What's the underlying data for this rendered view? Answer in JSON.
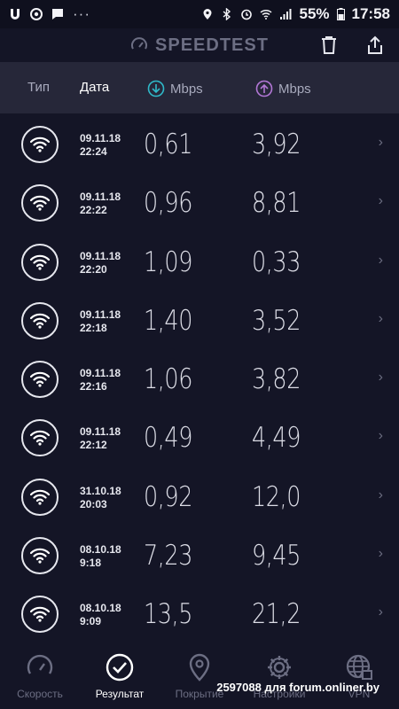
{
  "status_bar": {
    "battery": "55%",
    "time": "17:58",
    "left_icons": [
      "u-app-icon",
      "chrome-icon",
      "message-icon"
    ],
    "right_icons": [
      "location-icon",
      "bluetooth-icon",
      "alarm-icon",
      "wifi-icon",
      "signal-icon",
      "battery-icon"
    ]
  },
  "app_bar": {
    "title": "SPEEDTEST"
  },
  "header": {
    "type_label": "Тип",
    "date_label": "Дата",
    "download_label": "Mbps",
    "upload_label": "Mbps",
    "download_color": "#2fb9c9",
    "upload_color": "#b277d6"
  },
  "results": [
    {
      "date": "09.11.18",
      "time": "22:24",
      "down": "0,61",
      "up": "3,92"
    },
    {
      "date": "09.11.18",
      "time": "22:22",
      "down": "0,96",
      "up": "8,81"
    },
    {
      "date": "09.11.18",
      "time": "22:20",
      "down": "1,09",
      "up": "0,33"
    },
    {
      "date": "09.11.18",
      "time": "22:18",
      "down": "1,40",
      "up": "3,52"
    },
    {
      "date": "09.11.18",
      "time": "22:16",
      "down": "1,06",
      "up": "3,82"
    },
    {
      "date": "09.11.18",
      "time": "22:12",
      "down": "0,49",
      "up": "4,49"
    },
    {
      "date": "31.10.18",
      "time": "20:03",
      "down": "0,92",
      "up": "12,0"
    },
    {
      "date": "08.10.18",
      "time": "9:18",
      "down": "7,23",
      "up": "9,45"
    },
    {
      "date": "08.10.18",
      "time": "9:09",
      "down": "13,5",
      "up": "21,2"
    }
  ],
  "tabs": [
    {
      "label": "Скорость",
      "icon": "speedometer-icon"
    },
    {
      "label": "Результат",
      "icon": "check-circle-icon"
    },
    {
      "label": "Покрытие",
      "icon": "map-pin-icon"
    },
    {
      "label": "Настройки",
      "icon": "gear-icon"
    },
    {
      "label": "VPN",
      "icon": "globe-lock-icon"
    }
  ],
  "watermark": "2597088 для forum.onliner.by"
}
